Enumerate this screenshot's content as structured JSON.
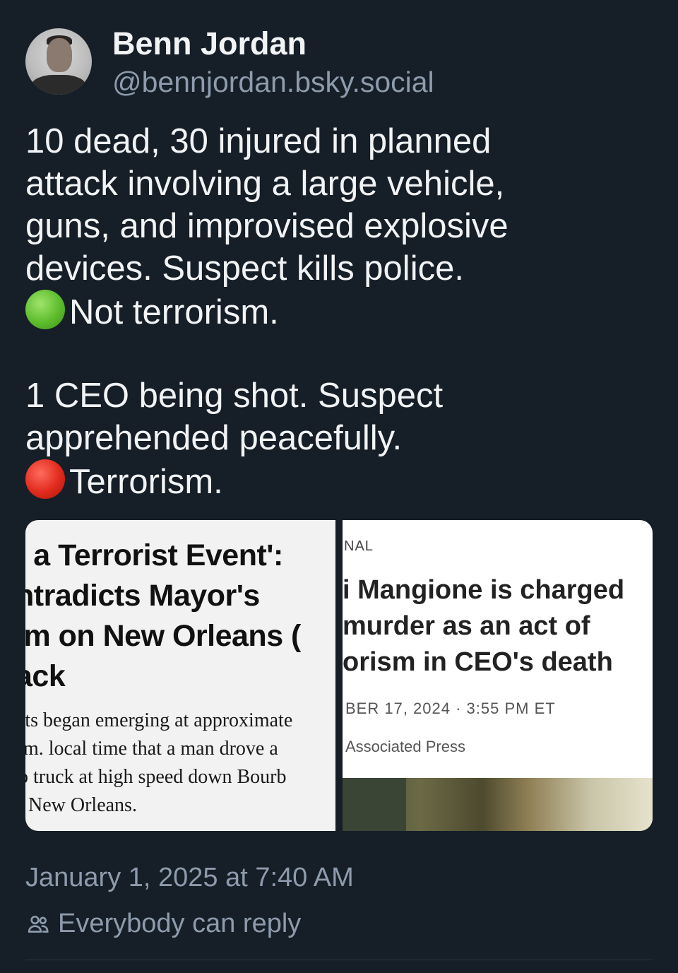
{
  "author": {
    "display_name": "Benn Jordan",
    "handle": "@bennjordan.bsky.social"
  },
  "post": {
    "lines_1": [
      "10 dead, 30 injured in planned",
      "attack involving a large vehicle,",
      "guns, and improvised explosive",
      "devices. Suspect kills police."
    ],
    "line_green": "Not terrorism.",
    "lines_2": [
      "1 CEO being shot. Suspect",
      "apprehended peacefully."
    ],
    "line_red": "Terrorism."
  },
  "embed": {
    "image1": {
      "headline": [
        "t a Terrorist Event':",
        "ntradicts Mayor's",
        "im on New Orleans (",
        "ack"
      ],
      "body": [
        "rts began emerging at approximate",
        ".m. local time that a man drove a",
        "p truck at high speed down Bourb",
        ", New Orleans."
      ]
    },
    "image2": {
      "kicker": "NAL",
      "headline": [
        "i Mangione is charged",
        " murder as an act of",
        "orism in CEO's death"
      ],
      "dateline": "BER 17, 2024 · 3:55 PM ET",
      "byline": "Associated Press"
    }
  },
  "meta": {
    "timestamp": "January 1, 2025 at 7:40 AM",
    "reply_setting": "Everybody can reply"
  },
  "icons": {
    "green_dot": "green-circle-icon",
    "red_dot": "red-circle-icon",
    "reply": "people-icon"
  }
}
